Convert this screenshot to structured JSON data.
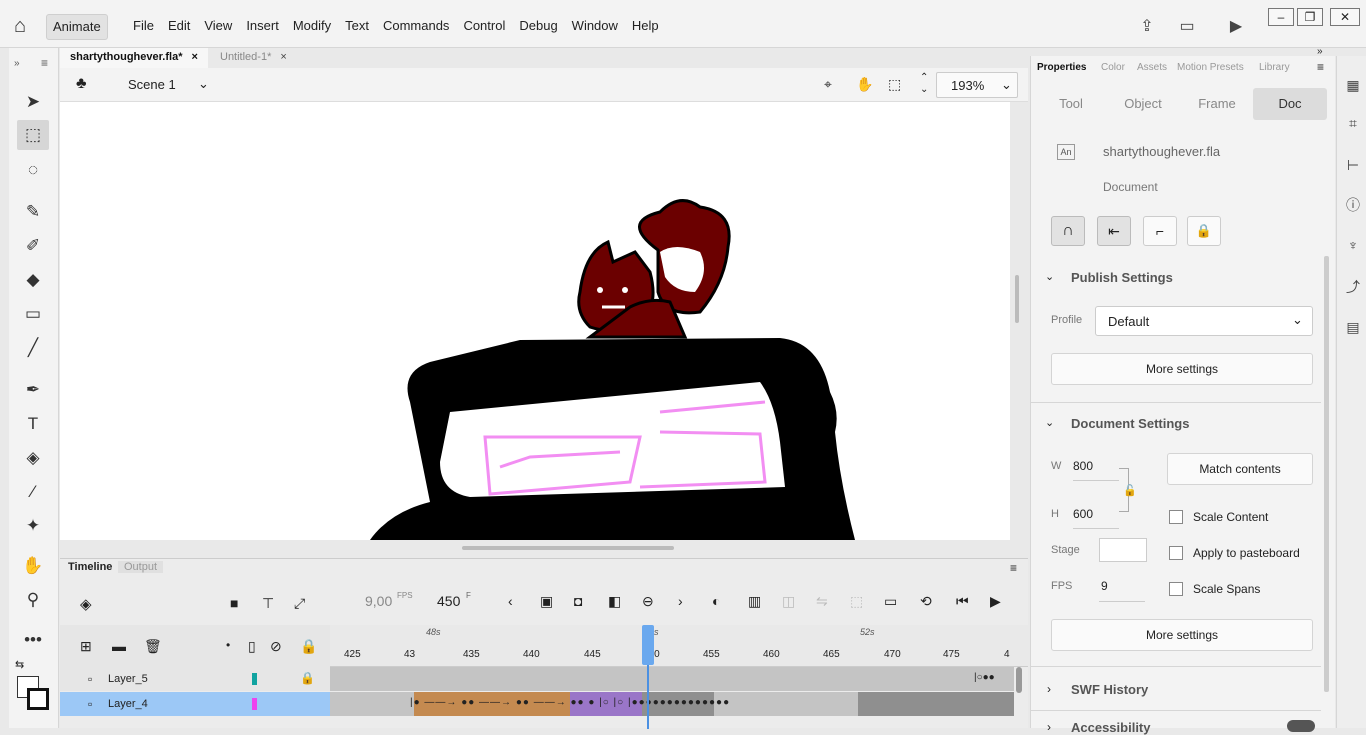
{
  "app": {
    "name": "Animate"
  },
  "menus": [
    "File",
    "Edit",
    "View",
    "Insert",
    "Modify",
    "Text",
    "Commands",
    "Control",
    "Debug",
    "Window",
    "Help"
  ],
  "doc_tabs": [
    {
      "label": "shartythoughever.fla*",
      "close": "×"
    },
    {
      "label": "Untitled-1*",
      "close": "×"
    }
  ],
  "editbar": {
    "scene": "Scene 1",
    "zoom": "193%"
  },
  "timeline": {
    "tabs": [
      "Timeline",
      "Output"
    ],
    "fps": "9,00",
    "fps_unit": "FPS",
    "frame": "450",
    "frame_unit": "F",
    "time_markers": [
      "48s",
      "50s",
      "52s"
    ],
    "ruler": [
      "425",
      "43",
      "435",
      "440",
      "445",
      "450",
      "455",
      "460",
      "465",
      "470",
      "475",
      "4"
    ],
    "layers": [
      {
        "name": "Layer_5",
        "color": "#11a3a0"
      },
      {
        "name": "Layer_4",
        "color": "#ee44ee"
      }
    ]
  },
  "properties": {
    "tabs": [
      "Properties",
      "Color",
      "Assets",
      "Motion Presets",
      "Library"
    ],
    "segments": [
      "Tool",
      "Object",
      "Frame",
      "Doc"
    ],
    "doc_icon": "An",
    "filename": "shartythoughever.fla",
    "doc_type": "Document",
    "publish_settings": {
      "header": "Publish Settings",
      "profile_label": "Profile",
      "profile": "Default",
      "more": "More settings"
    },
    "document_settings": {
      "header": "Document Settings",
      "w_label": "W",
      "w": "800",
      "h_label": "H",
      "h": "600",
      "match": "Match contents",
      "stage_label": "Stage",
      "fps_label": "FPS",
      "fps": "9",
      "scale_content": "Scale Content",
      "apply_pasteboard": "Apply to pasteboard",
      "scale_spans": "Scale Spans",
      "more": "More settings"
    },
    "swf_history": "SWF History",
    "accessibility": "Accessibility"
  }
}
